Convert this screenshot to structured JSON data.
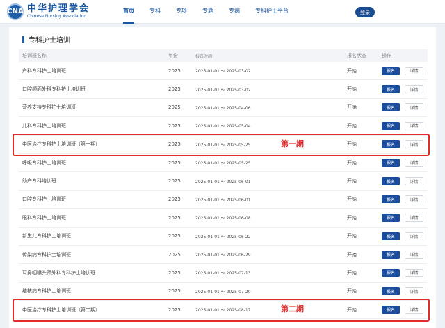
{
  "brand": {
    "name_cn": "中华护理学会",
    "name_en": "Chinese Nursing Association",
    "mark": "CNA"
  },
  "nav": [
    "首页",
    "专科",
    "专项",
    "专题",
    "专病",
    "专科护士平台"
  ],
  "nav_active": 0,
  "header": {
    "login_label": "登录"
  },
  "section": {
    "title": "专科护士培训"
  },
  "table": {
    "headers": [
      "培训班名称",
      "年份",
      "报名时间",
      "报名状态",
      "操作"
    ],
    "signup_label": "报名",
    "detail_label": "详情",
    "rows": [
      {
        "name": "产科专科护士培训班",
        "year": "2025",
        "period": "2025-01-01 ～ 2025-03-02",
        "status": "开始"
      },
      {
        "name": "口腔颌面外科专科护士培训班",
        "year": "2025",
        "period": "2025-01-01 ～ 2025-03-02",
        "status": "开始"
      },
      {
        "name": "营养支持专科护士培训班",
        "year": "2025",
        "period": "2025-01-01 ～ 2025-04-06",
        "status": "开始"
      },
      {
        "name": "儿科专科护士培训班",
        "year": "2025",
        "period": "2025-01-01 ～ 2025-05-04",
        "status": "开始"
      },
      {
        "name": "中医治疗专科护士培训班（第一期）",
        "year": "2025",
        "period": "2025-01-01 ～ 2025-05-25",
        "status": "开始"
      },
      {
        "name": "呼吸专科护士培训班",
        "year": "2025",
        "period": "2025-01-01 ～ 2025-05-25",
        "status": "开始"
      },
      {
        "name": "助产专科培训班",
        "year": "2025",
        "period": "2025-01-01 ～ 2025-06-01",
        "status": "开始"
      },
      {
        "name": "口腔专科护士培训班",
        "year": "2025",
        "period": "2025-01-01 ～ 2025-06-01",
        "status": "开始"
      },
      {
        "name": "眼科专科护士培训班",
        "year": "2025",
        "period": "2025-01-01 ～ 2025-06-08",
        "status": "开始"
      },
      {
        "name": "新生儿专科护士培训班",
        "year": "2025",
        "period": "2025-01-01 ～ 2025-06-22",
        "status": "开始"
      },
      {
        "name": "传染病专科护士培训班",
        "year": "2025",
        "period": "2025-01-01 ～ 2025-06-29",
        "status": "开始"
      },
      {
        "name": "耳鼻咽喉头颈外科专科护士培训班",
        "year": "2025",
        "period": "2025-01-01 ～ 2025-07-13",
        "status": "开始"
      },
      {
        "name": "结核病专科护士培训班",
        "year": "2025",
        "period": "2025-01-01 ～ 2025-07-20",
        "status": "开始"
      },
      {
        "name": "中医治疗专科护士培训班（第二期）",
        "year": "2025",
        "period": "2025-01-01 ～ 2025-08-17",
        "status": "开始"
      }
    ]
  },
  "annotations": [
    {
      "row": 4,
      "text": "第一期"
    },
    {
      "row": 13,
      "text": "第二期"
    }
  ],
  "colors": {
    "brand": "#1a56a0",
    "signup_button": "#1a4d9e",
    "annotation": "#e22b2b"
  }
}
